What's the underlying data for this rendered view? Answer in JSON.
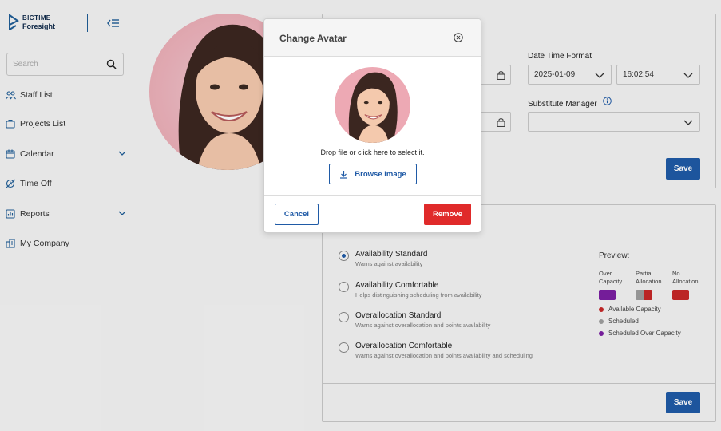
{
  "app": {
    "logo_line1": "BIGTIME",
    "logo_line2": "Foresight"
  },
  "sidebar": {
    "search_placeholder": "Search",
    "items": [
      {
        "label": "Staff List",
        "icon": "staff-icon",
        "has_chevron": false
      },
      {
        "label": "Projects List",
        "icon": "projects-icon",
        "has_chevron": false
      },
      {
        "label": "Calendar",
        "icon": "calendar-icon",
        "has_chevron": true
      },
      {
        "label": "Time Off",
        "icon": "time-off-icon",
        "has_chevron": false
      },
      {
        "label": "Reports",
        "icon": "reports-icon",
        "has_chevron": true
      },
      {
        "label": "My Company",
        "icon": "company-icon",
        "has_chevron": false
      }
    ]
  },
  "settings": {
    "date_time_format_label": "Date Time Format",
    "date_value": "2025-01-09",
    "time_value": "16:02:54",
    "substitute_manager_label": "Substitute Manager",
    "substitute_manager_value": "",
    "save_label": "Save"
  },
  "availability": {
    "options": [
      {
        "title": "Availability Standard",
        "desc": "Warns against availability",
        "checked": true
      },
      {
        "title": "Availability Comfortable",
        "desc": "Helps distinguishing scheduling from availability",
        "checked": false
      },
      {
        "title": "Overallocation Standard",
        "desc": "Warns against overallocation and points availability",
        "checked": false
      },
      {
        "title": "Overallocation Comfortable",
        "desc": "Warns against overallocation and points availability and scheduling",
        "checked": false
      }
    ],
    "preview_label": "Preview:",
    "preview_cols": [
      {
        "line1": "Over",
        "line2": "Capacity"
      },
      {
        "line1": "Partial",
        "line2": "Allocation"
      },
      {
        "line1": "No",
        "line2": "Allocation"
      }
    ],
    "legend": [
      {
        "label": "Available Capacity",
        "color": "#c62828"
      },
      {
        "label": "Scheduled",
        "color": "#9e9e9e"
      },
      {
        "label": "Scheduled Over Capacity",
        "color": "#7b1fa2"
      }
    ],
    "save_label": "Save"
  },
  "modal": {
    "title": "Change Avatar",
    "drop_text": "Drop file or click here to select it.",
    "browse_label": "Browse Image",
    "cancel_label": "Cancel",
    "remove_label": "Remove"
  },
  "colors": {
    "primary": "#1f5aa6",
    "danger": "#e02a2a",
    "over_capacity": "#7b1fa2",
    "no_allocation": "#c62828",
    "partial_grey": "#9e9e9e"
  }
}
